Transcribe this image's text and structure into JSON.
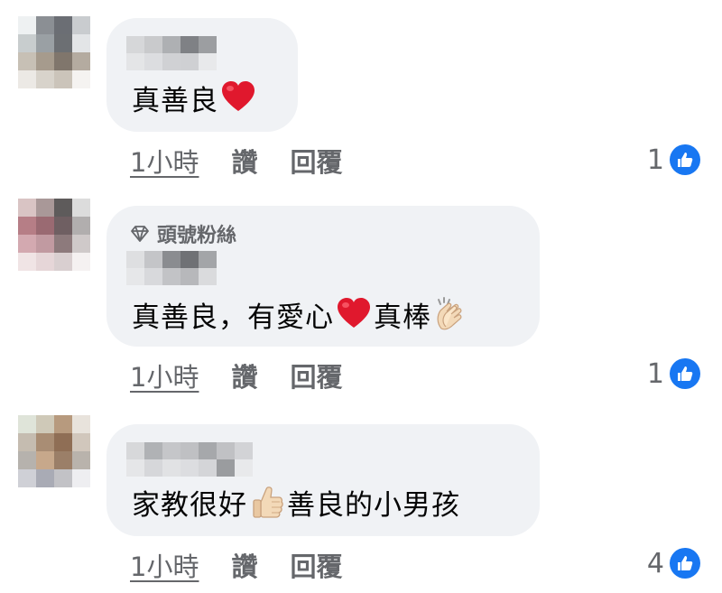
{
  "comments": [
    {
      "badge": "",
      "text": "真善良",
      "text_after": "",
      "time": "1小時",
      "like_label": "讚",
      "reply_label": "回覆",
      "reaction_count": "1",
      "emoji1": "red-heart",
      "emoji2": ""
    },
    {
      "badge": "頭號粉絲",
      "text": "真善良，有愛心",
      "text_after": "真棒",
      "time": "1小時",
      "like_label": "讚",
      "reply_label": "回覆",
      "reaction_count": "1",
      "emoji1": "red-heart",
      "emoji2": "clapping-hands"
    },
    {
      "badge": "",
      "text": "家教很好",
      "text_after": " 善良的小男孩",
      "time": "1小時",
      "like_label": "讚",
      "reply_label": "回覆",
      "reaction_count": "4",
      "emoji1": "thumbs-up",
      "emoji2": ""
    }
  ],
  "colors": {
    "bubble": "#f0f2f5",
    "like_blue": "#1877f2",
    "meta_gray": "#65676b",
    "heart_red": "#e0182d"
  }
}
